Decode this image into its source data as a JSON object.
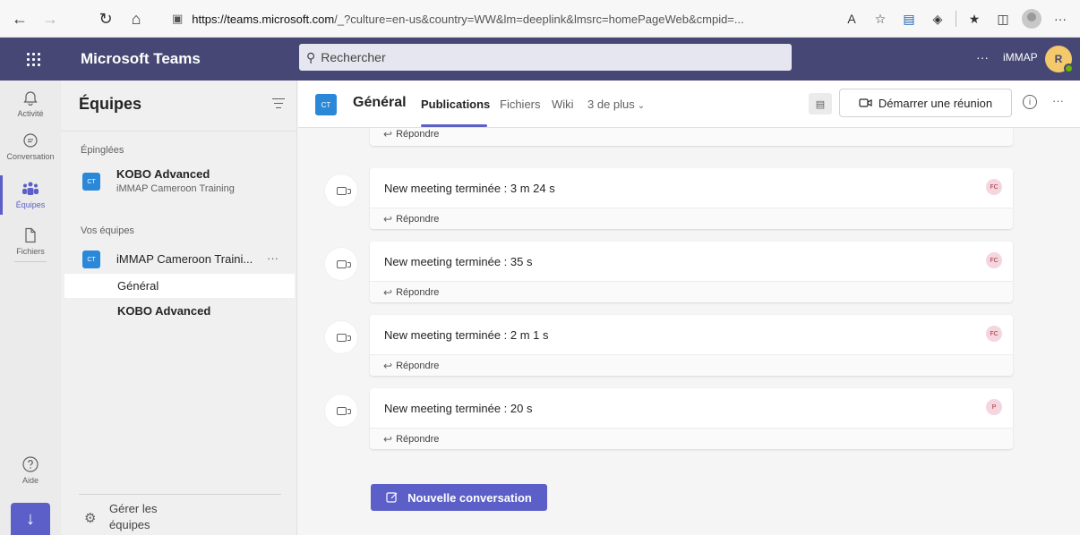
{
  "browser": {
    "url_host": "https://teams.microsoft.com",
    "url_rest": "/_?culture=en-us&country=WW&lm=deeplink&lmsrc=homePageWeb&cmpid=...",
    "back_glyph": "←",
    "forward_glyph": "→",
    "refresh_glyph": "↻",
    "home_glyph": "⌂",
    "read_aloud_label": "A",
    "more_glyph": "···"
  },
  "header": {
    "app_name": "Microsoft Teams",
    "search_placeholder": "Rechercher",
    "more_glyph": "···",
    "org_name": "iMMAP",
    "avatar_initial": "R",
    "colors": {
      "header_bg": "#464775",
      "accent": "#5b5fc7",
      "tile": "#2b88d8",
      "presence": "#6bb700"
    }
  },
  "rail": {
    "items": [
      {
        "label": "Activité",
        "icon": "bell-icon"
      },
      {
        "label": "Conversation",
        "icon": "chat-icon"
      },
      {
        "label": "Équipes",
        "icon": "teams-icon",
        "active": true
      },
      {
        "label": "Fichiers",
        "icon": "file-icon"
      }
    ],
    "help_label": "Aide",
    "download_glyph": "↓"
  },
  "pane": {
    "title": "Équipes",
    "pinned_label": "Épinglées",
    "pinned_team": {
      "tile": "CT",
      "name": "KOBO Advanced",
      "sub": "iMMAP Cameroon Training"
    },
    "your_teams_label": "Vos équipes",
    "team": {
      "tile": "CT",
      "name": "iMMAP Cameroon Traini...",
      "more": "···"
    },
    "channels": [
      {
        "name": "Général",
        "selected": true
      },
      {
        "name": "KOBO Advanced",
        "bold": true
      }
    ],
    "manage_label": "Gérer les équipes"
  },
  "channel": {
    "tile": "CT",
    "name": "Général",
    "tabs": [
      "Publications",
      "Fichiers",
      "Wiki"
    ],
    "more_tabs": "3 de plus",
    "meet_button": "Démarrer une réunion",
    "info_glyph": "i",
    "more_glyph": "···"
  },
  "feed": {
    "top_reply": "Répondre",
    "posts": [
      {
        "text": "New meeting terminée : 3 m 24 s",
        "badge": "FC",
        "reply": "Répondre"
      },
      {
        "text": "New meeting terminée : 35 s",
        "badge": "FC",
        "reply": "Répondre"
      },
      {
        "text": "New meeting terminée : 2 m 1 s",
        "badge": "FC",
        "reply": "Répondre"
      },
      {
        "text": "New meeting terminée : 20 s",
        "badge": "P",
        "reply": "Répondre"
      }
    ],
    "new_conversation": "Nouvelle conversation"
  }
}
